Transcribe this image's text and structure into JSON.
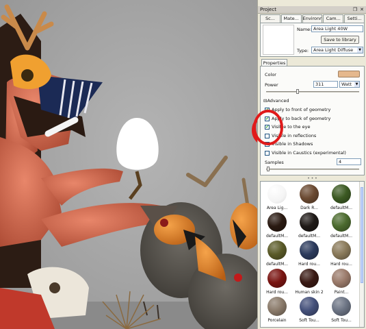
{
  "panel": {
    "title": "Project",
    "tabs": [
      "Sc...",
      "Mate...",
      "Environm...",
      "Cam...",
      "Setti..."
    ],
    "active_tab": 1
  },
  "material": {
    "name_label": "Name:",
    "name_value": "Area Light 40W",
    "save_button": "Save to library",
    "type_label": "Type:",
    "type_value": "Area Light Diffuse"
  },
  "properties": {
    "tab_label": "Properties",
    "color_label": "Color",
    "color_value": "#e5b88d",
    "power_label": "Power",
    "power_value": "311",
    "power_unit": "Watt",
    "advanced_label": "Advanced",
    "checkboxes": [
      {
        "label": "Apply to front of geometry",
        "checked": true
      },
      {
        "label": "Apply to back of geometry",
        "checked": true
      },
      {
        "label": "Visible to the eye",
        "checked": true
      },
      {
        "label": "Visible in reflections",
        "checked": false
      },
      {
        "label": "Visible in Shadows",
        "checked": false
      },
      {
        "label": "Visible in Caustics (experimental)",
        "checked": false
      }
    ],
    "samples_label": "Samples",
    "samples_value": "4"
  },
  "library": {
    "items": [
      {
        "label": "Area Lig...",
        "color": "#ffffff"
      },
      {
        "label": "Dark R...",
        "color": "#6b4a32"
      },
      {
        "label": "defaultM...",
        "color": "#3c5a23"
      },
      {
        "label": "defaultM...",
        "color": "#2a1a12"
      },
      {
        "label": "defaultM...",
        "color": "#1f1a17"
      },
      {
        "label": "defaultM...",
        "color": "#4c6b2f"
      },
      {
        "label": "defaultM...",
        "color": "#5a5a28"
      },
      {
        "label": "Hard rou...",
        "color": "#2b3a5c"
      },
      {
        "label": "Hard rou...",
        "color": "#8a7a5a"
      },
      {
        "label": "Hard rou...",
        "color": "#7a1512"
      },
      {
        "label": "Human skin 2",
        "color": "#3a1a14"
      },
      {
        "label": "Paint...",
        "color": "#9a7a6a"
      },
      {
        "label": "Porcelain",
        "color": "#8a7a6a"
      },
      {
        "label": "Soft Tou...",
        "color": "#44507a"
      },
      {
        "label": "Soft Tou...",
        "color": "#6c7484"
      }
    ]
  },
  "colors": {
    "viewport_bg": "#a6a6a6",
    "annotation_ring": "#e01a1a"
  }
}
